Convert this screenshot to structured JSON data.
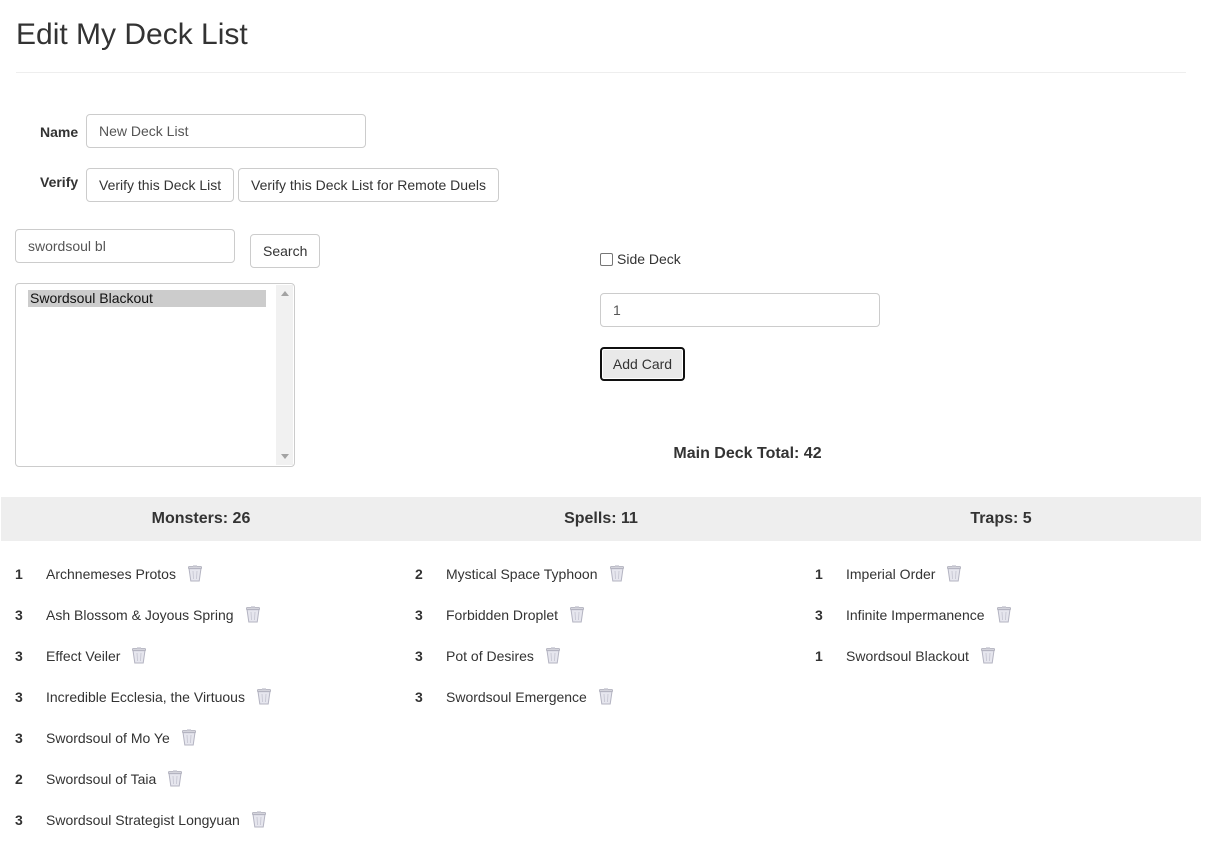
{
  "page": {
    "title": "Edit My Deck List"
  },
  "form": {
    "name_label": "Name",
    "name_value": "New Deck List",
    "verify_label": "Verify",
    "verify_button": "Verify this Deck List",
    "verify_remote_button": "Verify this Deck List for Remote Duels"
  },
  "search": {
    "query": "swordsoul bl",
    "button": "Search",
    "results": [
      "Swordsoul Blackout"
    ]
  },
  "add": {
    "side_deck_label": "Side Deck",
    "side_deck_checked": false,
    "quantity": "1",
    "button": "Add Card"
  },
  "totals": {
    "main_deck": "Main Deck Total: 42"
  },
  "categories": {
    "monsters": "Monsters: 26",
    "spells": "Spells: 11",
    "traps": "Traps: 5"
  },
  "monsters": [
    {
      "qty": "1",
      "name": "Archnemeses Protos"
    },
    {
      "qty": "3",
      "name": "Ash Blossom & Joyous Spring"
    },
    {
      "qty": "3",
      "name": "Effect Veiler"
    },
    {
      "qty": "3",
      "name": "Incredible Ecclesia, the Virtuous"
    },
    {
      "qty": "3",
      "name": "Swordsoul of Mo Ye"
    },
    {
      "qty": "2",
      "name": "Swordsoul of Taia"
    },
    {
      "qty": "3",
      "name": "Swordsoul Strategist Longyuan"
    }
  ],
  "spells": [
    {
      "qty": "2",
      "name": "Mystical Space Typhoon"
    },
    {
      "qty": "3",
      "name": "Forbidden Droplet"
    },
    {
      "qty": "3",
      "name": "Pot of Desires"
    },
    {
      "qty": "3",
      "name": "Swordsoul Emergence"
    }
  ],
  "traps": [
    {
      "qty": "1",
      "name": "Imperial Order"
    },
    {
      "qty": "3",
      "name": "Infinite Impermanence"
    },
    {
      "qty": "1",
      "name": "Swordsoul Blackout"
    }
  ],
  "icons": {
    "remove": "trash-icon"
  },
  "colors": {
    "category_bar": "#eeeeee",
    "selected_option": "#cccccc"
  }
}
